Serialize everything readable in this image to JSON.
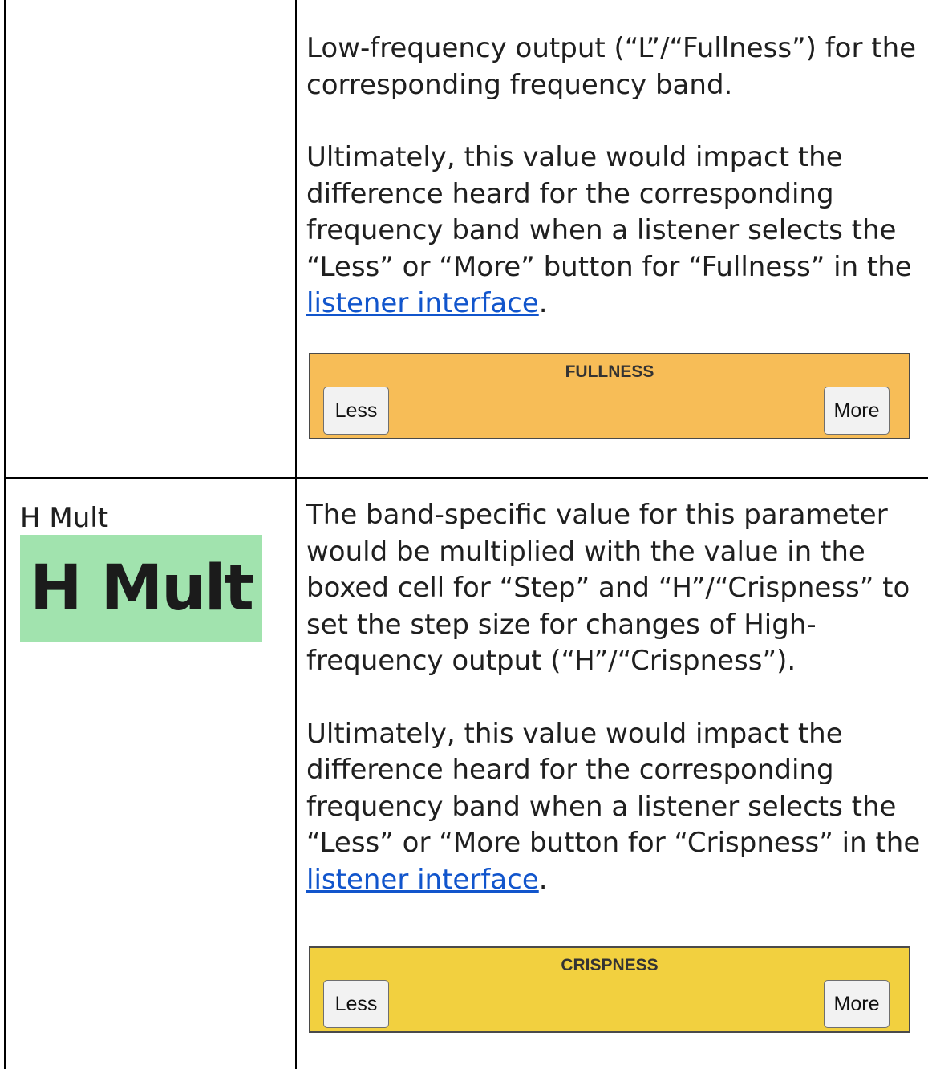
{
  "rows": [
    {
      "label": "",
      "paragraph1": "Low-frequency output (“L”/“Fullness”) for the corresponding frequency band.",
      "paragraph2_pre": "Ultimately, this value would impact the difference heard for the corresponding frequency band when a listener selects the “Less” or “More” button for “Fullness” in the ",
      "link_text": "listener interface",
      "paragraph2_post": ".",
      "control": {
        "title": "FULLNESS",
        "less_label": "Less",
        "more_label": "More",
        "color": "#f7bd57"
      }
    },
    {
      "label": "H Mult",
      "badge_text": "H Mult",
      "paragraph1": "The band-specific value for this parameter would be multiplied with the value in the boxed cell for “Step” and “H”/“Crispness” to set the step size for changes of High-frequency output (“H”/“Crispness”).",
      "paragraph2_pre": "Ultimately, this value would impact the difference heard for the corresponding frequency band when a listener selects the “Less” or “More button for “Crispness” in the ",
      "link_text": "listener interface",
      "paragraph2_post": ".",
      "control": {
        "title": "CRISPNESS",
        "less_label": "Less",
        "more_label": "More",
        "color": "#f2d03f"
      }
    }
  ]
}
